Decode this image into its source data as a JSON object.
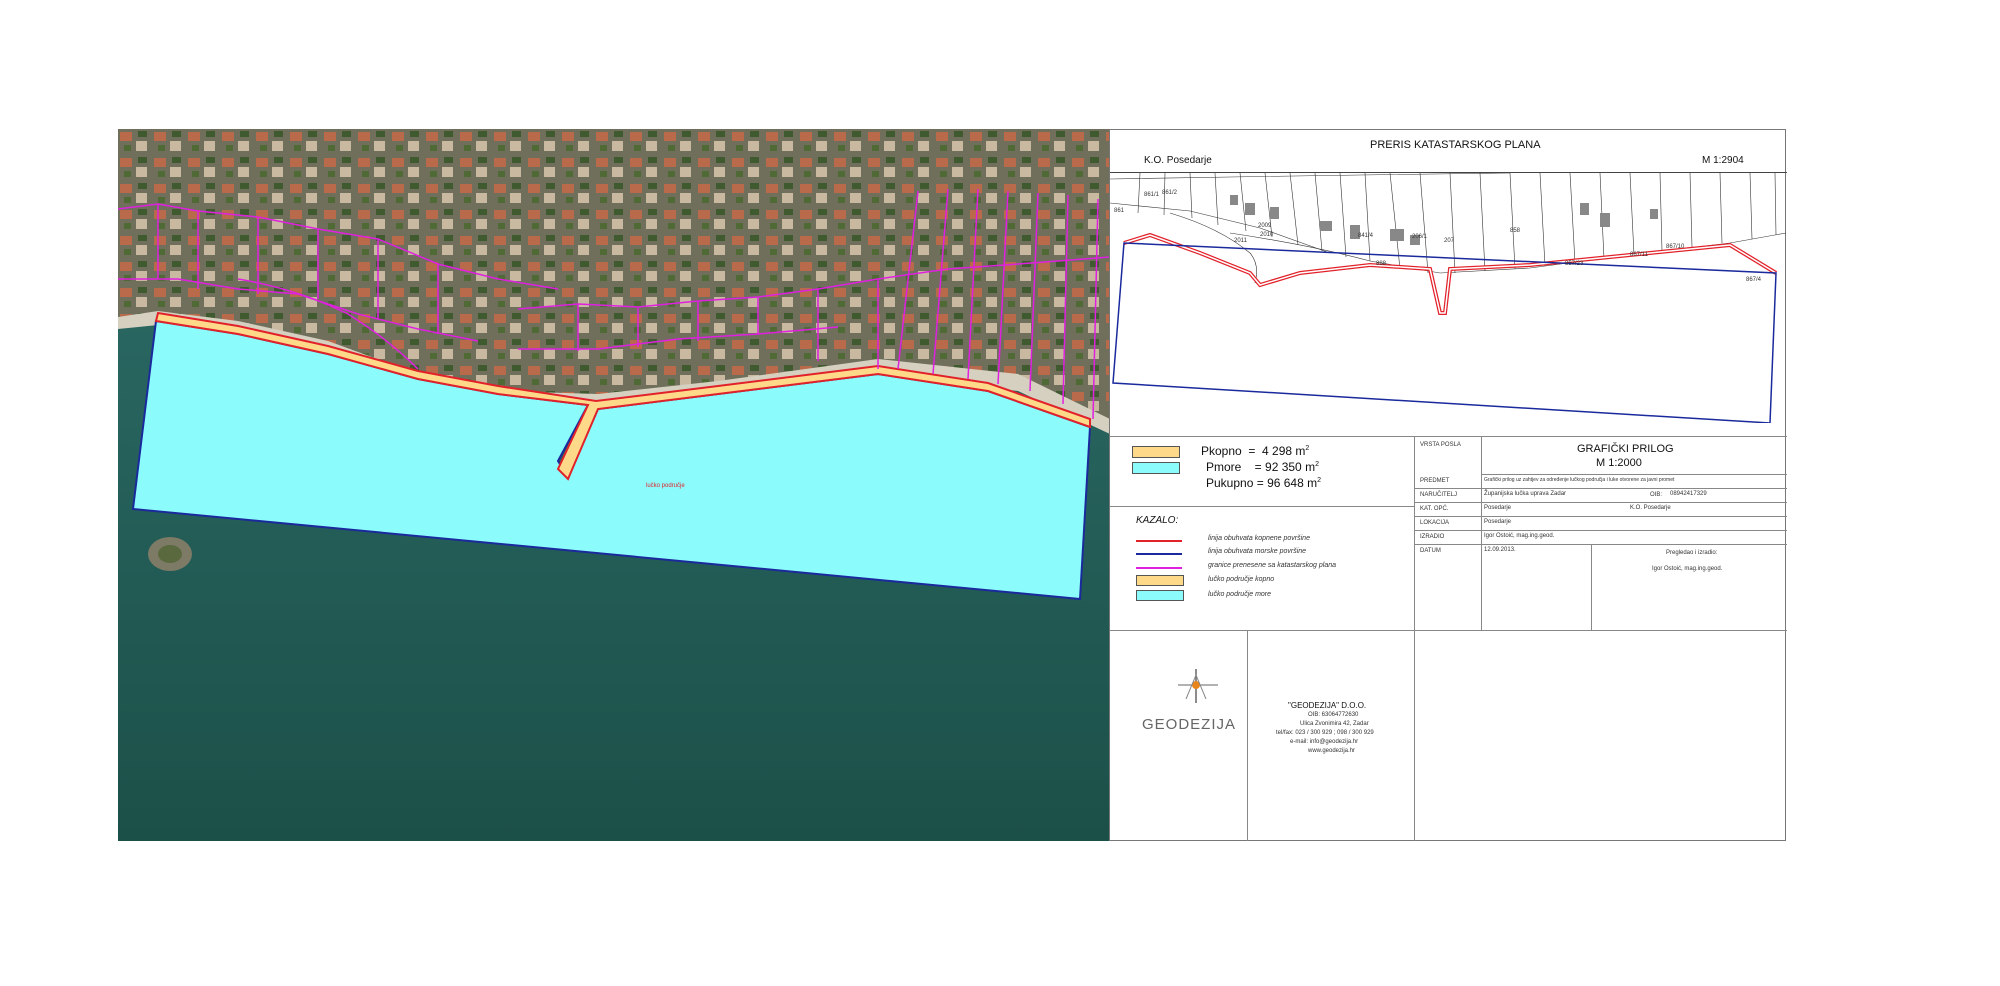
{
  "colors": {
    "land_zone": "#ffd98a",
    "sea_zone": "#8cfbfb",
    "land_boundary": "#e2222a",
    "sea_boundary": "#1a2a9c",
    "cadastral_lines": "#e020e0",
    "sea_water": "#1f5c55"
  },
  "map": {
    "center_label": "lučko područje"
  },
  "plan": {
    "title": "PRERIS KATASTARSKOG PLANA",
    "ko": "K.O. Posedarje",
    "scale": "M 1:2904",
    "parcels": [
      "861/2",
      "861/1",
      "861",
      "2011",
      "2010",
      "2009",
      "206/2",
      "206/1",
      "207",
      "858",
      "857/23",
      "857/3",
      "857/2",
      "857/12",
      "867/11",
      "867/9",
      "867/10",
      "867/5",
      "867/3",
      "867/4",
      "3224/2",
      "1581",
      "888",
      "841/4"
    ]
  },
  "areas": [
    {
      "name": "Pkopno",
      "value": "4 298",
      "unit": "m",
      "color": "#ffd98a"
    },
    {
      "name": "Pmore",
      "value": "92 350",
      "unit": "m",
      "color": "#8cfbfb"
    },
    {
      "name": "Pukupno",
      "value": "96 648",
      "unit": "m",
      "color": ""
    }
  ],
  "kazalo": {
    "title": "KAZALO:",
    "items": [
      {
        "label": "linija obuhvata kopnene površine",
        "color": "#e2222a",
        "kind": "line"
      },
      {
        "label": "linija obuhvata morske površine",
        "color": "#1a2a9c",
        "kind": "line"
      },
      {
        "label": "granice prenesene sa katastarskog plana",
        "color": "#e020e0",
        "kind": "line"
      },
      {
        "label": "lučko područje kopno",
        "color": "#ffd98a",
        "kind": "fill"
      },
      {
        "label": "lučko područje more",
        "color": "#8cfbfb",
        "kind": "fill"
      }
    ]
  },
  "titleblock": {
    "vrsta_posla_label": "VRSTA POSLA",
    "title": "GRAFIČKI PRILOG",
    "scale": "M 1:2000",
    "predmet_label": "PREDMET",
    "predmet": "Grafički prilog uz zahtjev za određenje lučkog područja i luke otvorene za javni promet",
    "narucitelj_label": "NARUČITELJ",
    "narucitelj": "Županijska lučka uprava Zadar",
    "oib_label": "OIB:",
    "oib": "08942417329",
    "kat_opc_label": "KAT. OPĆ.",
    "kat_opc": "Posedarje",
    "ko_value": "K.O. Posedarje",
    "lokacija_label": "LOKACIJA",
    "lokacija": "Posedarje",
    "izradio_label": "IZRADIO",
    "izradio": "Igor Ostoić, mag.ing.geod.",
    "datum_label": "DATUM",
    "datum": "12.09.2013.",
    "pregledao_label": "Pregledao i izradio:",
    "pregledao": "Igor Ostoić, mag.ing.geod."
  },
  "company": {
    "logo_text": "GEODEZIJA",
    "name": "\"GEODEZIJA\" D.O.O.",
    "oib": "OIB: 63064772630",
    "address": "Ulica Zvonimira 42, Zadar",
    "phone": "tel/fax: 023 / 300 929 ; 098 / 300 929",
    "email": "e-mail: info@geodezija.hr",
    "web": "www.geodezija.hr"
  }
}
